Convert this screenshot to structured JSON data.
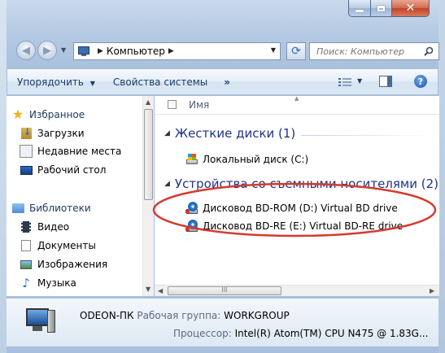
{
  "window": {
    "close_glyph": "✕"
  },
  "nav": {
    "back_glyph": "◀",
    "forward_glyph": "▶",
    "address_path": "Компьютер",
    "search_placeholder": "Поиск: Компьютер"
  },
  "toolbar": {
    "organize": "Упорядочить",
    "system_properties": "Свойства системы",
    "more": "»",
    "help": "?"
  },
  "sidebar": {
    "favorites": "Избранное",
    "downloads": "Загрузки",
    "recent": "Недавние места",
    "desktop": "Рабочий стол",
    "libraries": "Библиотеки",
    "video": "Видео",
    "documents": "Документы",
    "images": "Изображения",
    "music": "Музыка"
  },
  "content": {
    "column_name": "Имя",
    "groups": [
      {
        "label": "Жесткие диски (1)",
        "items": [
          "Локальный диск (C:)"
        ]
      },
      {
        "label": "Устройства со съемными носителями (2)",
        "items": [
          "Дисковод BD-ROM (D:) Virtual BD drive",
          "Дисковод BD-RE (E:) Virtual BD-RE drive"
        ]
      }
    ]
  },
  "scroll": {
    "hthumb_grip": "III"
  },
  "details": {
    "computer_name": "ODEON-ПК",
    "workgroup_label": "Рабочая группа:",
    "workgroup_value": "WORKGROUP",
    "cpu_label": "Процессор:",
    "cpu_value": "Intel(R) Atom(TM) CPU N475  @ 1.83G..."
  },
  "colors": {
    "annotation": "#d63a2f",
    "group_header": "#1e3287",
    "toolbar_text": "#1b3a66"
  }
}
